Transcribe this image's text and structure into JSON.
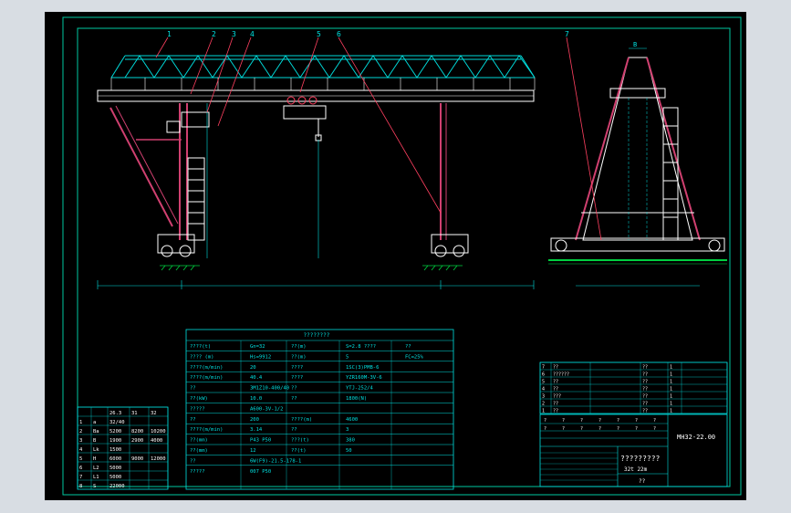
{
  "colors": {
    "background": "#000000",
    "frame": "#00c8a0",
    "structure": "#ffffff",
    "column": "#d04070",
    "dimension": "#00e0e0",
    "hatch": "#00d040",
    "leader": "#ff4060",
    "text": "#00e0e0",
    "yellow": "#e8e800"
  },
  "elevation_view": {
    "part_numbers": [
      "1",
      "2",
      "3",
      "4",
      "5",
      "6"
    ]
  },
  "side_view": {
    "part_numbers": [
      "7"
    ],
    "top_label": "B"
  },
  "tech_table": {
    "title": "????????",
    "rows": [
      [
        "????(t)",
        "Gn=32",
        "??(m)",
        "S=2.8 ????",
        "??"
      ],
      [
        "???? (m)",
        "Hs=9912",
        "??(m)",
        "5",
        "FC=25%"
      ],
      [
        "????(m/min)",
        "20",
        "????",
        "1SC(3)PMB-6"
      ],
      [
        "????(m/min)",
        "40.4",
        "????",
        "YZR160M-3V-6"
      ],
      [
        "??",
        "3M1Z10-400/40",
        "??",
        "YTJ-252/4"
      ],
      [
        "??(kW)",
        "10.0",
        "??",
        "1800(N)"
      ],
      [
        "?????",
        "A600-3V-1/2"
      ],
      [
        "??",
        "200",
        "????(m)",
        "4600"
      ],
      [
        "????(m/min)",
        "3.14",
        "??",
        "3"
      ],
      [
        "??(mm)",
        "P43 P50",
        "???(t)",
        "380"
      ],
      [
        "??(mm)",
        "12",
        "??(t)",
        "50"
      ],
      [
        "??",
        "6W(F9)-21.5-178-1"
      ],
      [
        "?????",
        "007 P50"
      ]
    ]
  },
  "spec_table": {
    "header": [
      "",
      "",
      "26.3",
      "31",
      "32"
    ],
    "rows": [
      [
        "1",
        "a",
        "32/40",
        "",
        ""
      ],
      [
        "2",
        "Ba",
        "5200",
        "8200",
        "10200"
      ],
      [
        "3",
        "B",
        "1900",
        "2900",
        "4000"
      ],
      [
        "4",
        "Lk",
        "1500",
        "",
        ""
      ],
      [
        "5",
        "H",
        "6000",
        "9000",
        "12000"
      ],
      [
        "6",
        "L2",
        "5000",
        "",
        ""
      ],
      [
        "7",
        "L1",
        "5000",
        "",
        ""
      ],
      [
        "8",
        "S",
        "22000",
        "",
        ""
      ]
    ]
  },
  "parts_list": {
    "rows": [
      [
        "7",
        "??",
        "",
        "??",
        "1",
        ""
      ],
      [
        "6",
        "??????",
        "",
        "??",
        "1",
        ""
      ],
      [
        "5",
        "??",
        "",
        "??",
        "1",
        ""
      ],
      [
        "4",
        "??",
        "",
        "??",
        "1",
        ""
      ],
      [
        "3",
        "???",
        "",
        "??",
        "1",
        ""
      ],
      [
        "2",
        "??",
        "",
        "??",
        "1",
        ""
      ],
      [
        "1",
        "??",
        "",
        "??",
        "1",
        ""
      ]
    ]
  },
  "title_block": {
    "drawing_number": "MH32-22.00",
    "title": "?????????",
    "subtitle": "32t 22m",
    "footer": "??",
    "small_cells": [
      "?",
      "?",
      "?",
      "?",
      "?",
      "?",
      "?",
      "?",
      "?",
      "?",
      "?",
      "?",
      "?",
      "?"
    ]
  }
}
